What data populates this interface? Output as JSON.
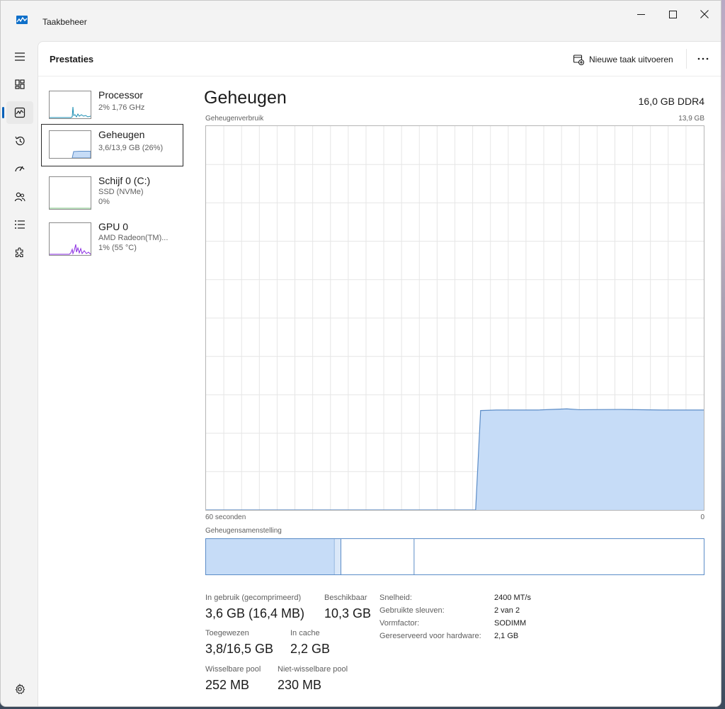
{
  "window": {
    "title": "Taakbeheer"
  },
  "header": {
    "title": "Prestaties",
    "new_task_label": "Nieuwe taak uitvoeren"
  },
  "sidebar": {
    "items": [
      {
        "name": "Processor",
        "line1": "2%  1,76 GHz",
        "line2": ""
      },
      {
        "name": "Geheugen",
        "line1": "3,6/13,9 GB (26%)",
        "line2": ""
      },
      {
        "name": "Schijf 0 (C:)",
        "line1": "SSD (NVMe)",
        "line2": "0%"
      },
      {
        "name": "GPU 0",
        "line1": "AMD Radeon(TM)...",
        "line2": "1%  (55 °C)"
      }
    ]
  },
  "main": {
    "title": "Geheugen",
    "memory_type": "16,0 GB DDR4",
    "usage_label": "Geheugenverbruik",
    "usage_max": "13,9 GB",
    "x_left": "60 seconden",
    "x_right": "0",
    "composition_label": "Geheugensamenstelling"
  },
  "stats": {
    "in_use_label": "In gebruik (gecomprimeerd)",
    "in_use_value": "3,6 GB (16,4 MB)",
    "available_label": "Beschikbaar",
    "available_value": "10,3 GB",
    "committed_label": "Toegewezen",
    "committed_value": "3,8/16,5 GB",
    "cached_label": "In cache",
    "cached_value": "2,2 GB",
    "paged_label": "Wisselbare pool",
    "paged_value": "252 MB",
    "nonpaged_label": "Niet-wisselbare pool",
    "nonpaged_value": "230 MB"
  },
  "specs": [
    {
      "label": "Snelheid:",
      "value": "2400 MT/s"
    },
    {
      "label": "Gebruikte sleuven:",
      "value": "2 van 2"
    },
    {
      "label": "Vormfactor:",
      "value": "SODIMM"
    },
    {
      "label": "Gereserveerd voor hardware:",
      "value": "2,1 GB"
    }
  ],
  "colors": {
    "accent": "#005fb8",
    "memory_line": "#5b8cc7",
    "memory_fill": "#c6dcf7",
    "cpu": "#1a8eb3",
    "gpu": "#8a2be2"
  },
  "chart_data": {
    "type": "area",
    "title": "Geheugenverbruik",
    "ylim": [
      0,
      13.9
    ],
    "xlim": [
      60,
      0
    ],
    "series": [
      {
        "x": [
          60,
          27.5,
          26.9,
          25,
          20,
          16.5,
          15,
          10,
          5,
          0
        ],
        "values": [
          0,
          0,
          3.6,
          3.62,
          3.62,
          3.66,
          3.63,
          3.64,
          3.62,
          3.62
        ]
      }
    ],
    "composition": {
      "in_use_fraction": 0.258,
      "modified_fraction": 0.013,
      "standby_fraction": 0.147
    }
  }
}
